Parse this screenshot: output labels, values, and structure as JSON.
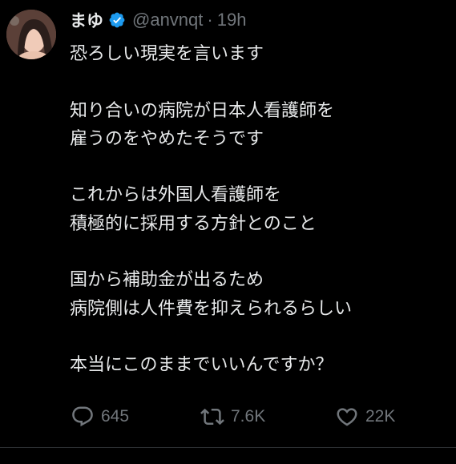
{
  "tweet": {
    "author": {
      "display_name": "まゆ",
      "handle": "@anvnqt",
      "verified": true,
      "verified_icon": "verified-badge-icon",
      "verified_color": "#1d9bf0"
    },
    "separator": "·",
    "timestamp": "19h",
    "lines": [
      "恐ろしい現実を言います",
      "",
      "知り合いの病院が日本人看護師を",
      "雇うのをやめたそうです",
      "",
      "これからは外国人看護師を",
      "積極的に採用する方針とのこと",
      "",
      "国から補助金が出るため",
      "病院側は人件費を抑えられるらしい",
      "",
      "本当にこのままでいいんですか？"
    ],
    "actions": {
      "reply": {
        "icon": "reply-icon",
        "count": "645"
      },
      "retweet": {
        "icon": "retweet-icon",
        "count": "7.6K"
      },
      "like": {
        "icon": "heart-icon",
        "count": "22K"
      }
    }
  },
  "colors": {
    "background": "#000000",
    "text_primary": "#e7e9ea",
    "text_secondary": "#71767b",
    "divider": "#2f3336"
  }
}
